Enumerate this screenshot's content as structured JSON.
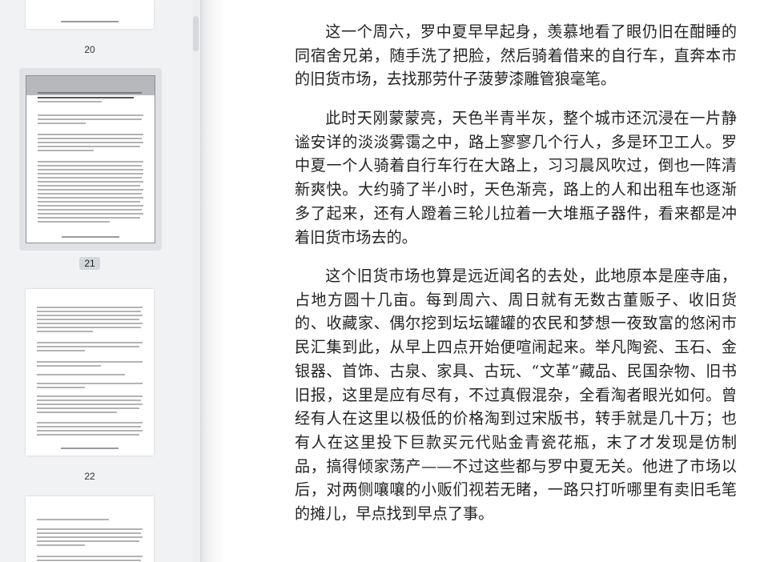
{
  "sidebar": {
    "pages": [
      {
        "number": "20",
        "current": false
      },
      {
        "number": "21",
        "current": true
      },
      {
        "number": "22",
        "current": false
      }
    ]
  },
  "document": {
    "paragraphs": [
      "这一个周六，罗中夏早早起身，羡慕地看了眼仍旧在酣睡的同宿舍兄弟，随手洗了把脸，然后骑着借来的自行车，直奔本市的旧货市场，去找那劳什子菠萝漆雕管狼毫笔。",
      "此时天刚蒙蒙亮，天色半青半灰，整个城市还沉浸在一片静谧安详的淡淡雾霭之中，路上寥寥几个行人，多是环卫工人。罗中夏一个人骑着自行车行在大路上，习习晨风吹过，倒也一阵清新爽快。大约骑了半小时，天色渐亮，路上的人和出租车也逐渐多了起来，还有人蹬着三轮儿拉着一大堆瓶子器件，看来都是冲着旧货市场去的。",
      "这个旧货市场也算是远近闻名的去处，此地原本是座寺庙，占地方圆十几亩。每到周六、周日就有无数古董贩子、收旧货的、收藏家、偶尔挖到坛坛罐罐的农民和梦想一夜致富的悠闲市民汇集到此，从早上四点开始便喧闹起来。举凡陶瓷、玉石、金银器、首饰、古泉、家具、古玩、“文革”藏品、民国杂物、旧书旧报，这里是应有尽有，不过真假混杂，全看淘者眼光如何。曾经有人在这里以极低的价格淘到过宋版书，转手就是几十万；也有人在这里投下巨款买元代贴金青瓷花瓶，末了才发现是仿制品，搞得倾家荡产——不过这些都与罗中夏无关。他进了市场以后，对两侧嚷嚷的小贩们视若无睹，一路只打听哪里有卖旧毛笔的摊儿，早点找到早点了事。"
    ]
  }
}
